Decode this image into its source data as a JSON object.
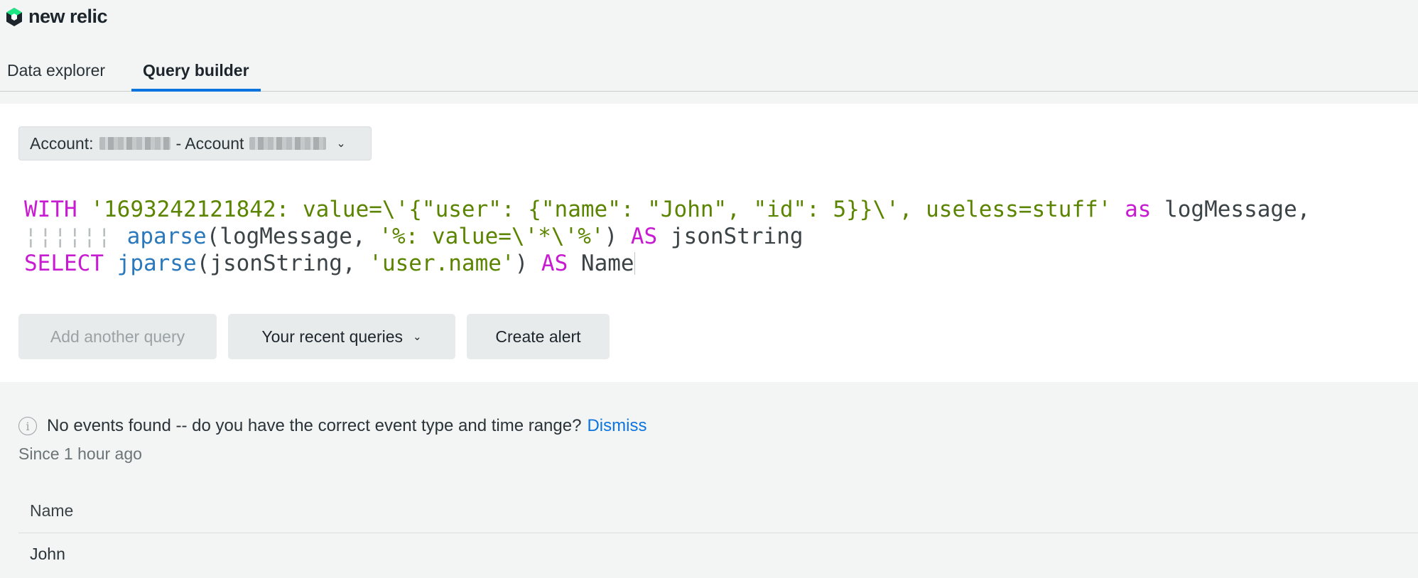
{
  "brand": {
    "name": "new relic",
    "logo_color": "#1ce783"
  },
  "tabs": [
    {
      "label": "Data explorer",
      "active": false
    },
    {
      "label": "Query builder",
      "active": true
    }
  ],
  "account": {
    "label": "Account:",
    "separator": "- Account",
    "icon": "chevron-down-icon"
  },
  "query": {
    "lines": [
      [
        "WITH",
        "'1693242121842: value=\\'{\"user\": {\"name\": \"John\", \"id\": 5}}\\', useless=stuff'",
        "as",
        "logMessage,"
      ],
      [
        "aparse",
        "(logMessage, ",
        "'%: value=\\'*\\'%'",
        ") ",
        "AS",
        " jsonString"
      ],
      [
        "SELECT",
        "jparse",
        "(jsonString, ",
        "'user.name'",
        ") ",
        "AS",
        " Name"
      ]
    ]
  },
  "buttons": {
    "add_query": "Add another query",
    "recent": "Your recent queries",
    "create_alert": "Create alert"
  },
  "notice": {
    "message": "No events found -- do you have the correct event type and time range?",
    "dismiss": "Dismiss",
    "since": "Since 1 hour ago"
  },
  "results": {
    "columns": [
      "Name"
    ],
    "rows": [
      [
        "John"
      ]
    ]
  }
}
